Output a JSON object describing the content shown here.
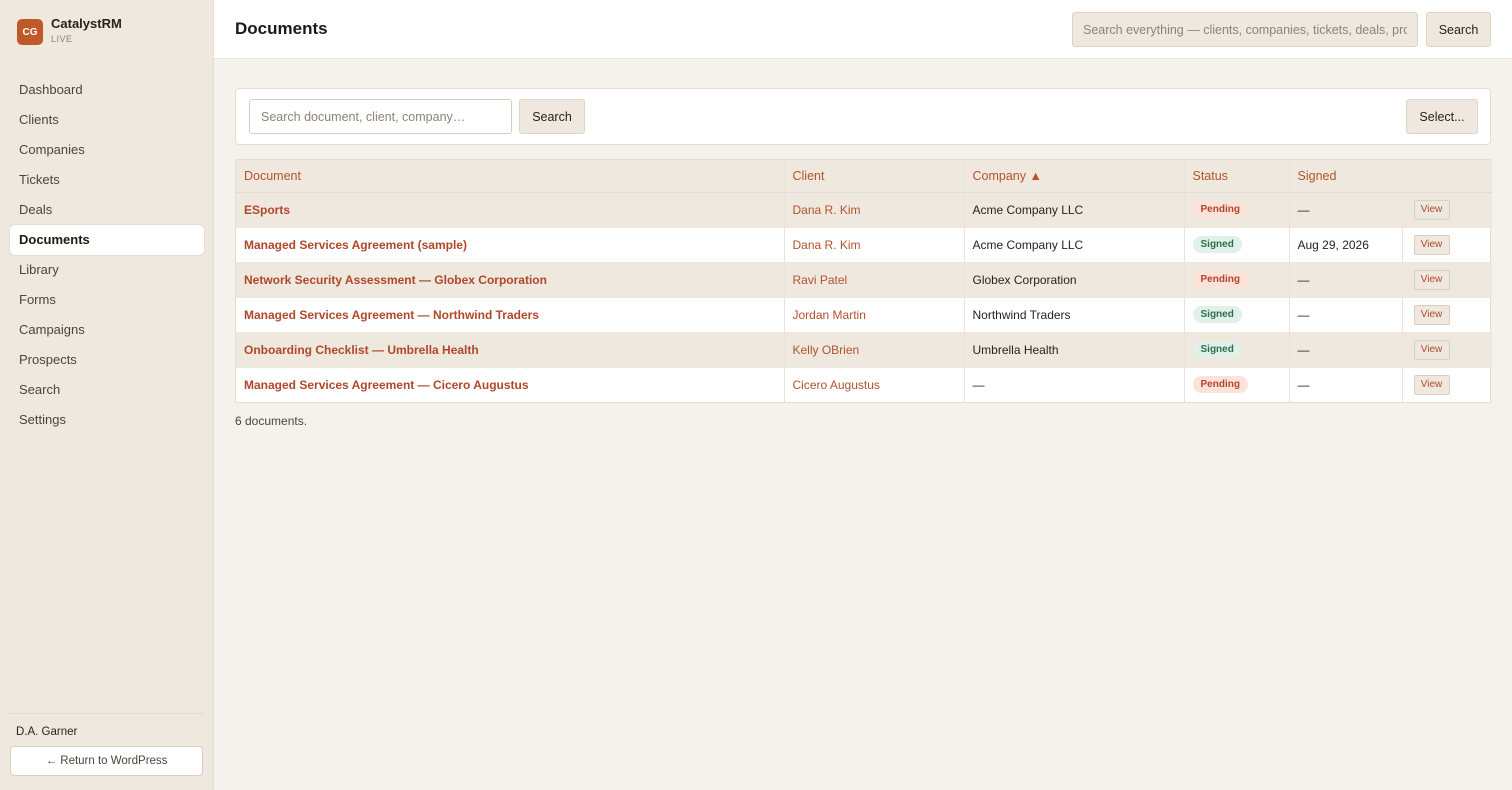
{
  "brand": {
    "logo": "CG",
    "name": "CatalystRM",
    "env": "LIVE"
  },
  "nav": [
    {
      "label": "Dashboard"
    },
    {
      "label": "Clients"
    },
    {
      "label": "Companies"
    },
    {
      "label": "Tickets"
    },
    {
      "label": "Deals"
    },
    {
      "label": "Documents",
      "active": true
    },
    {
      "label": "Library"
    },
    {
      "label": "Forms"
    },
    {
      "label": "Campaigns"
    },
    {
      "label": "Prospects"
    },
    {
      "label": "Search"
    },
    {
      "label": "Settings"
    }
  ],
  "footer": {
    "user": "D.A. Garner",
    "return_label": "← Return to WordPress"
  },
  "header": {
    "title": "Documents",
    "search_placeholder": "Search everything — clients, companies, tickets, deals, pro",
    "search_label": "Search"
  },
  "filter": {
    "placeholder": "Search document, client, company…",
    "search_label": "Search",
    "select_label": "Select..."
  },
  "table": {
    "columns": [
      "Document",
      "Client",
      "Company ▲",
      "Status",
      "Signed",
      ""
    ],
    "rows": [
      {
        "document": "ESports",
        "client": "Dana R. Kim",
        "company": "Acme Company LLC",
        "status": "Pending",
        "signed": "—",
        "action": "View"
      },
      {
        "document": "Managed Services Agreement (sample)",
        "client": "Dana R. Kim",
        "company": "Acme Company LLC",
        "status": "Signed",
        "signed": "Aug 29, 2026",
        "action": "View"
      },
      {
        "document": "Network Security Assessment — Globex Corporation",
        "client": "Ravi Patel",
        "company": "Globex Corporation",
        "status": "Pending",
        "signed": "—",
        "action": "View"
      },
      {
        "document": "Managed Services Agreement — Northwind Traders",
        "client": "Jordan Martin",
        "company": "Northwind Traders",
        "status": "Signed",
        "signed": "—",
        "action": "View"
      },
      {
        "document": "Onboarding Checklist — Umbrella Health",
        "client": "Kelly OBrien",
        "company": "Umbrella Health",
        "status": "Signed",
        "signed": "—",
        "action": "View"
      },
      {
        "document": "Managed Services Agreement — Cicero Augustus",
        "client": "Cicero Augustus",
        "company": "—",
        "status": "Pending",
        "signed": "—",
        "action": "View"
      }
    ]
  },
  "count_text": "6 documents."
}
